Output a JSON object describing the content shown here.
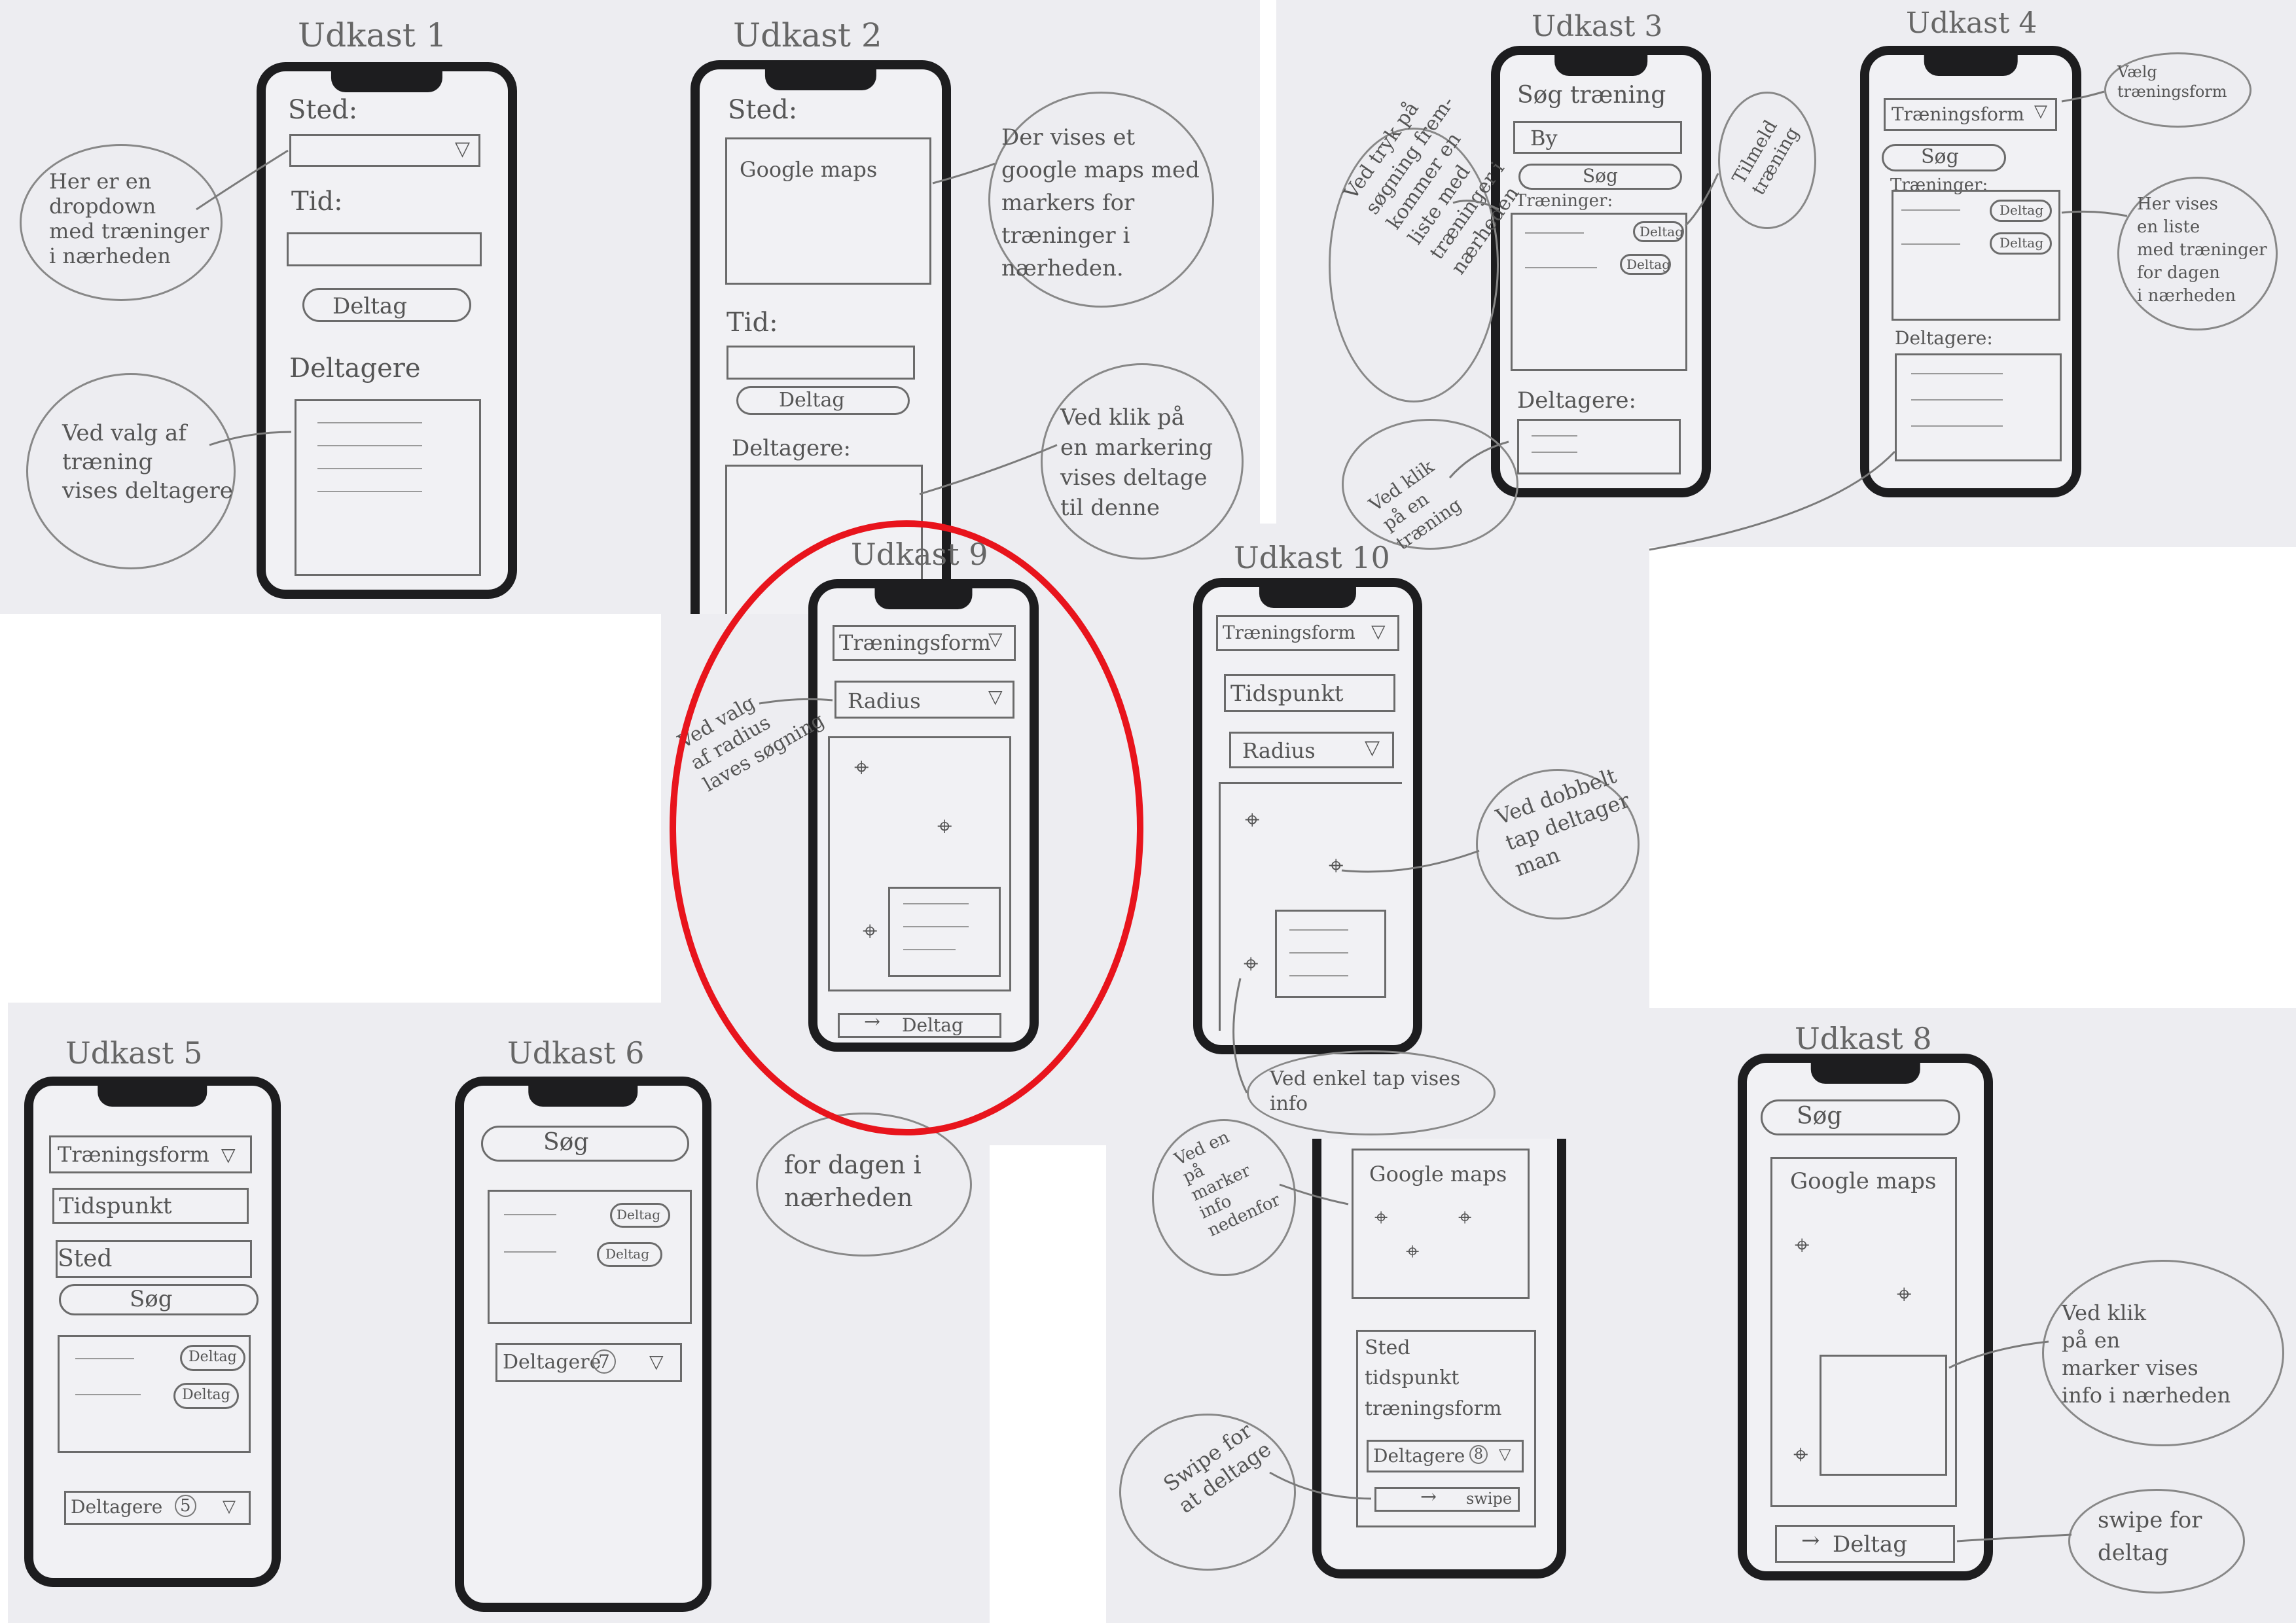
{
  "titles": {
    "u1": "Udkast 1",
    "u2": "Udkast 2",
    "u3": "Udkast 3",
    "u4": "Udkast 4",
    "u5": "Udkast 5",
    "u6": "Udkast 6",
    "u8": "Udkast 8",
    "u9": "Udkast 9",
    "u10": "Udkast 10"
  },
  "u1": {
    "sted": "Sted:",
    "tid": "Tid:",
    "deltag": "Deltag",
    "deltagere": "Deltagere",
    "note1": "Her er en\ndropdown\nmed træninger\ni nærheden",
    "note2": "Ved valg af\ntræning\nvises deltagere"
  },
  "u2": {
    "sted": "Sted:",
    "map": "Google maps",
    "tid": "Tid:",
    "deltag": "Deltag",
    "deltagere": "Deltagere:",
    "note1": "Der vises et\ngoogle maps med\nmarkers for\ntræninger i\nnærheden.",
    "note2": "Ved klik på\nen markering\nvises deltage\ntil denne"
  },
  "u3": {
    "title": "Søg træning",
    "by": "By",
    "soeg": "Søg",
    "traeninger": "Træninger:",
    "deltag": "Deltag",
    "deltagere": "Deltagere:",
    "note1": "Ved tryk på\nsøgning frem-\nkommer en\nliste med\ntræninger i\nnærheden",
    "note2": "Tilmeld\ntræning",
    "note3": "Ved klik\npå en\ntræning"
  },
  "u4": {
    "traeningsform": "Træningsform",
    "soeg": "Søg",
    "traeninger": "Træninger:",
    "deltag": "Deltag",
    "deltagere": "Deltagere:",
    "note1": "Vælg\ntræningsform",
    "note2": "Her vises\nen liste\nmed træninger\nfor dagen\ni nærheden"
  },
  "u9": {
    "traeningsform": "Træningsform",
    "radius": "Radius",
    "deltag": "Deltag",
    "note": "Ved valg\naf radius\nlaves søgning"
  },
  "u10": {
    "traeningsform": "Træningsform",
    "tidspunkt": "Tidspunkt",
    "radius": "Radius",
    "note1": "Ved dobbelt\ntap deltager\nman",
    "note2": "Ved enkel tap vises\ninfo"
  },
  "u5": {
    "traeningsform": "Træningsform",
    "tidspunkt": "Tidspunkt",
    "sted": "Sted",
    "soeg": "Søg",
    "deltag": "Deltag",
    "deltagere": "Deltagere",
    "count": "5",
    "note": "for dagen i\nnærheden"
  },
  "u6": {
    "soeg": "Søg",
    "deltag": "Deltag",
    "deltagere": "Deltagere",
    "count": "7"
  },
  "u7": {
    "map": "Google maps",
    "sted": "Sted",
    "tidspunkt": "tidspunkt",
    "traeningsform": "træningsform",
    "deltagere": "Deltagere",
    "count": "8",
    "swipe": "swipe",
    "note1": "Ved en\npå\nmarker\ninfo\nnedenfor",
    "note2": "Swipe for\nat deltage"
  },
  "u8": {
    "soeg": "Søg",
    "map": "Google maps",
    "deltag": "Deltag",
    "note1": "Ved klik\npå en\nmarker vises\ninfo i nærheden",
    "note2": "swipe for\ndeltag"
  },
  "colors": {
    "highlight": "#e8141c",
    "phone": "#1d1d1f",
    "paper": "#ededf1"
  }
}
